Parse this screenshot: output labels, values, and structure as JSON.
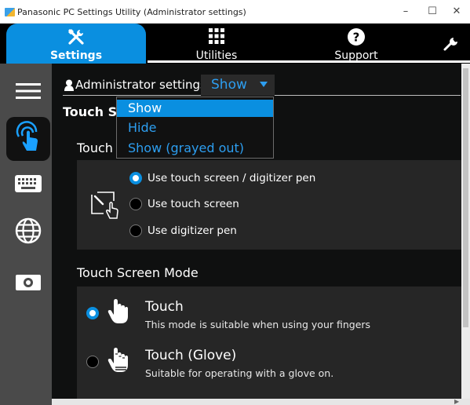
{
  "window": {
    "title": "Panasonic PC Settings Utility (Administrator settings)",
    "minimize": "–",
    "maximize": "☐",
    "close": "✕"
  },
  "tabs": [
    {
      "label": "Settings",
      "icon": "tools-icon",
      "selected": true
    },
    {
      "label": "Utilities",
      "icon": "grid-icon",
      "selected": false
    },
    {
      "label": "Support",
      "icon": "question-icon",
      "selected": false
    }
  ],
  "sidebar": {
    "items": [
      {
        "icon": "hamburger-menu-icon"
      },
      {
        "icon": "touch-icon",
        "selected": true
      },
      {
        "icon": "keyboard-icon"
      },
      {
        "icon": "globe-icon"
      },
      {
        "icon": "camera-icon"
      }
    ]
  },
  "admin": {
    "label": "Administrator settings",
    "selected_value": "Show",
    "options": [
      "Show",
      "Hide",
      "Show (grayed out)"
    ]
  },
  "sections": {
    "touch_screen_title": "Touch Sc",
    "touch_sub_title": "Touch",
    "touch_options": [
      {
        "label": "Use touch screen / digitizer pen",
        "selected": true
      },
      {
        "label": "Use touch screen",
        "selected": false
      },
      {
        "label": "Use digitizer pen",
        "selected": false
      }
    ],
    "mode_title": "Touch Screen Mode",
    "modes": [
      {
        "name": "Touch",
        "description": "This mode is suitable when using your fingers",
        "selected": true
      },
      {
        "name": "Touch (Glove)",
        "description": "Suitable for operating with a glove on.",
        "selected": false
      }
    ]
  },
  "colors": {
    "accent": "#0a8fe0",
    "link_blue": "#2d9ef0",
    "panel_bg": "#0f1010",
    "card_bg": "#262626",
    "sidebar_bg": "#4a4a4a"
  }
}
